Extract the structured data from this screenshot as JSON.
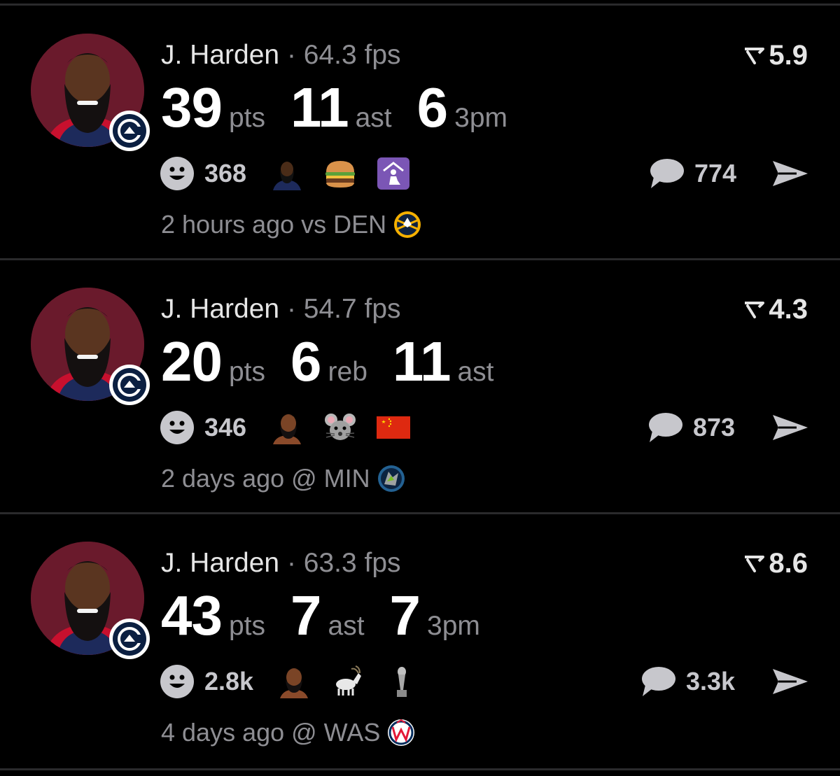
{
  "colors": {
    "background": "#000000",
    "divider": "#2a2a2c",
    "muted": "#8e8e93",
    "avatar_bg": "#6a1a2c"
  },
  "cards": [
    {
      "player": "J. Harden",
      "separator": "·",
      "fps": "64.3 fps",
      "rating": "5.9",
      "stats": [
        {
          "value": "39",
          "label": "pts"
        },
        {
          "value": "11",
          "label": "ast"
        },
        {
          "value": "6",
          "label": "3pm"
        }
      ],
      "reactions_count": "368",
      "emojis": [
        "harden-face-emoji",
        "hamburger-emoji",
        "place-of-worship-emoji"
      ],
      "comments_count": "774",
      "time": "2 hours ago vs DEN",
      "opponent_logo": "nuggets-logo"
    },
    {
      "player": "J. Harden",
      "separator": "·",
      "fps": "54.7 fps",
      "rating": "4.3",
      "stats": [
        {
          "value": "20",
          "label": "pts"
        },
        {
          "value": "6",
          "label": "reb"
        },
        {
          "value": "11",
          "label": "ast"
        }
      ],
      "reactions_count": "346",
      "emojis": [
        "harden-face-emoji",
        "mouse-emoji",
        "china-flag-emoji"
      ],
      "comments_count": "873",
      "time": "2 days ago @ MIN",
      "opponent_logo": "timberwolves-logo"
    },
    {
      "player": "J. Harden",
      "separator": "·",
      "fps": "63.3 fps",
      "rating": "8.6",
      "stats": [
        {
          "value": "43",
          "label": "pts"
        },
        {
          "value": "7",
          "label": "ast"
        },
        {
          "value": "7",
          "label": "3pm"
        }
      ],
      "reactions_count": "2.8k",
      "emojis": [
        "harden-face-emoji",
        "goat-emoji",
        "trophy-emoji"
      ],
      "comments_count": "3.3k",
      "time": "4 days ago @ WAS",
      "opponent_logo": "wizards-logo"
    }
  ]
}
